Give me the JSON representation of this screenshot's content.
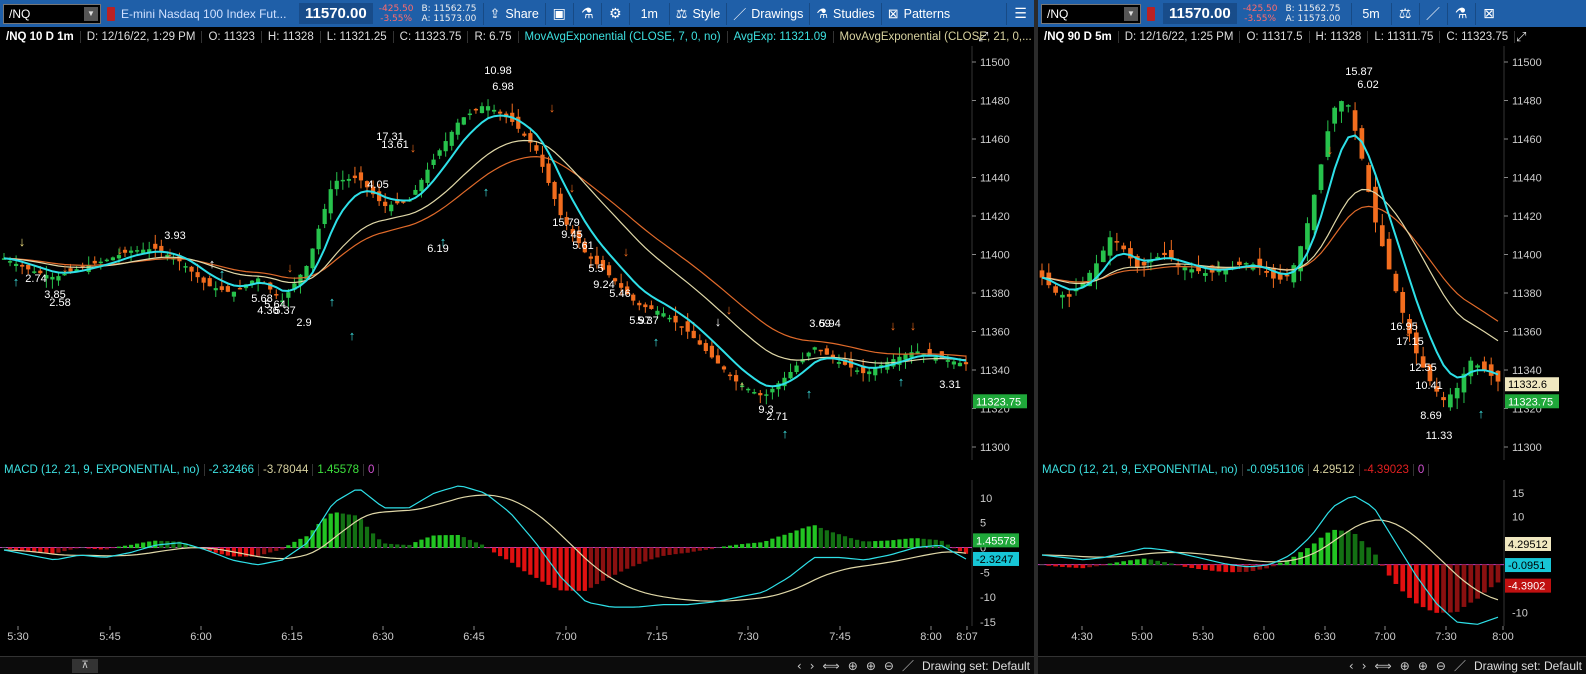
{
  "left": {
    "toolbar": {
      "symbol": "/NQ",
      "description": "E-mini Nasdaq 100 Index Fut...",
      "last": "11570.00",
      "change": "-425.50",
      "change_pct": "-3.55%",
      "bid": "B: 11562.75",
      "ask": "A: 11573.00",
      "share": "Share",
      "interval": "1m",
      "style": "Style",
      "drawings": "Drawings",
      "studies": "Studies",
      "patterns": "Patterns"
    },
    "info": {
      "title": "/NQ 10 D 1m",
      "date": "D: 12/16/22, 1:29 PM",
      "open": "O: 11323",
      "high": "H: 11328",
      "low": "L: 11321.25",
      "close": "C: 11323.75",
      "range": "R: 6.75",
      "ema7": "MovAvgExponential (CLOSE, 7, 0, no)",
      "ema7_val": "AvgExp: 11321.09",
      "ema21": "MovAvgExponential (CLOSE, 21, 0,..."
    },
    "price_axis": [
      "11500",
      "11480",
      "11460",
      "11440",
      "11420",
      "11400",
      "11380",
      "11360",
      "11340",
      "11320",
      "11300"
    ],
    "price_tag": "11323.75",
    "time_axis": [
      "5:30",
      "5:45",
      "6:00",
      "6:15",
      "6:30",
      "6:45",
      "7:00",
      "7:15",
      "7:30",
      "7:45",
      "8:00",
      "8:07"
    ],
    "labels": [
      "3.93",
      "2.74",
      "3.85",
      "2.58",
      "5.68",
      "5.64",
      "4.36",
      "5.37",
      "2.9",
      "17.31",
      "13.61",
      "4.05",
      "6.19",
      "10.98",
      "6.98",
      "15.79",
      "9.45",
      "5.61",
      "5.5",
      "9.24",
      "5.46",
      "5.97",
      "5.37",
      "9.3",
      "2.71",
      "3.69",
      "5.94",
      "3.31"
    ],
    "macd": {
      "title": "MACD (12, 21, 9, EXPONENTIAL, no)",
      "value": "-2.32466",
      "avg": "-3.78044",
      "diff": "1.45578",
      "zero": "0",
      "axis": [
        "10",
        "5",
        "0",
        "-5",
        "-10",
        "-15"
      ],
      "tag_diff": "1.45578",
      "tag_value": "-2.3247"
    },
    "footer": {
      "drawing_set": "Drawing set: Default"
    }
  },
  "right": {
    "toolbar": {
      "symbol": "/NQ",
      "last": "11570.00",
      "change": "-425.50",
      "change_pct": "-3.55%",
      "bid": "B: 11562.75",
      "ask": "A: 11573.00",
      "interval": "5m"
    },
    "info": {
      "title": "/NQ 90 D 5m",
      "date": "D: 12/16/22, 1:25 PM",
      "open": "O: 11317.5",
      "high": "H: 11328",
      "low": "L: 11311.75",
      "close": "C: 11323.75"
    },
    "price_axis": [
      "11500",
      "11480",
      "11460",
      "11440",
      "11420",
      "11400",
      "11380",
      "11360",
      "11340",
      "11320",
      "11300"
    ],
    "price_tag_ema": "11332.6",
    "price_tag": "11323.75",
    "time_axis": [
      "4:30",
      "5:00",
      "5:30",
      "6:00",
      "6:30",
      "7:00",
      "7:30",
      "8:00"
    ],
    "labels": [
      "15.87",
      "6.02",
      "16.95",
      "17.15",
      "12.55",
      "10.41",
      "8.69",
      "11.33"
    ],
    "macd": {
      "title": "MACD (12, 21, 9, EXPONENTIAL, no)",
      "value": "-0.0951106",
      "avg": "4.29512",
      "diff": "-4.39023",
      "zero": "0",
      "axis": [
        "15",
        "10",
        "5",
        "0",
        "-5",
        "-10"
      ],
      "tag_avg": "4.29512",
      "tag_value": "-0.0951",
      "tag_diff": "-4.3902"
    },
    "footer": {
      "drawing_set": "Drawing set: Default"
    }
  },
  "colors": {
    "up": "#27c24c",
    "down": "#f26d1e",
    "ema_fast": "#2ee0e8",
    "ema_slow": "#e0d8a8",
    "ema_slower": "#e06a2a",
    "macd_line": "#2ee0e8",
    "macd_avg": "#e0d8a8",
    "hist_up": "#22c422",
    "hist_down": "#e01010"
  }
}
